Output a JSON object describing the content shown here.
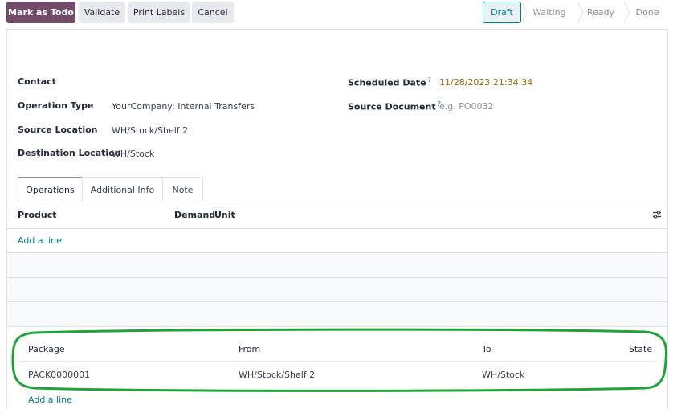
{
  "toolbar": {
    "mark_as_todo": "Mark as Todo",
    "validate": "Validate",
    "print_labels": "Print Labels",
    "cancel": "Cancel"
  },
  "statusbar": {
    "states": [
      "Draft",
      "Waiting",
      "Ready",
      "Done"
    ],
    "current": "Draft"
  },
  "form": {
    "contact_label": "Contact",
    "contact_value": "",
    "operation_type_label": "Operation Type",
    "operation_type_value": "YourCompany: Internal Transfers",
    "source_location_label": "Source Location",
    "source_location_value": "WH/Stock/Shelf 2",
    "destination_location_label": "Destination Location",
    "destination_location_value": "WH/Stock",
    "scheduled_date_label": "Scheduled Date",
    "scheduled_date_value": "11/28/2023 21:34:34",
    "source_document_label": "Source Document",
    "source_document_placeholder": "e.g. PO0032",
    "help_mark": "?"
  },
  "tabs": [
    "Operations",
    "Additional Info",
    "Note"
  ],
  "operations": {
    "columns": [
      "Product",
      "Demand",
      "Unit"
    ],
    "add_line": "Add a line"
  },
  "packages": {
    "columns": [
      "Package",
      "From",
      "To",
      "State"
    ],
    "rows": [
      {
        "package": "PACK0000001",
        "from": "WH/Stock/Shelf 2",
        "to": "WH/Stock",
        "state": ""
      }
    ],
    "add_line": "Add a line"
  },
  "colors": {
    "primary": "#714b67",
    "accent": "#017e84",
    "highlight": "#22a33a",
    "date": "#9a6a12"
  }
}
